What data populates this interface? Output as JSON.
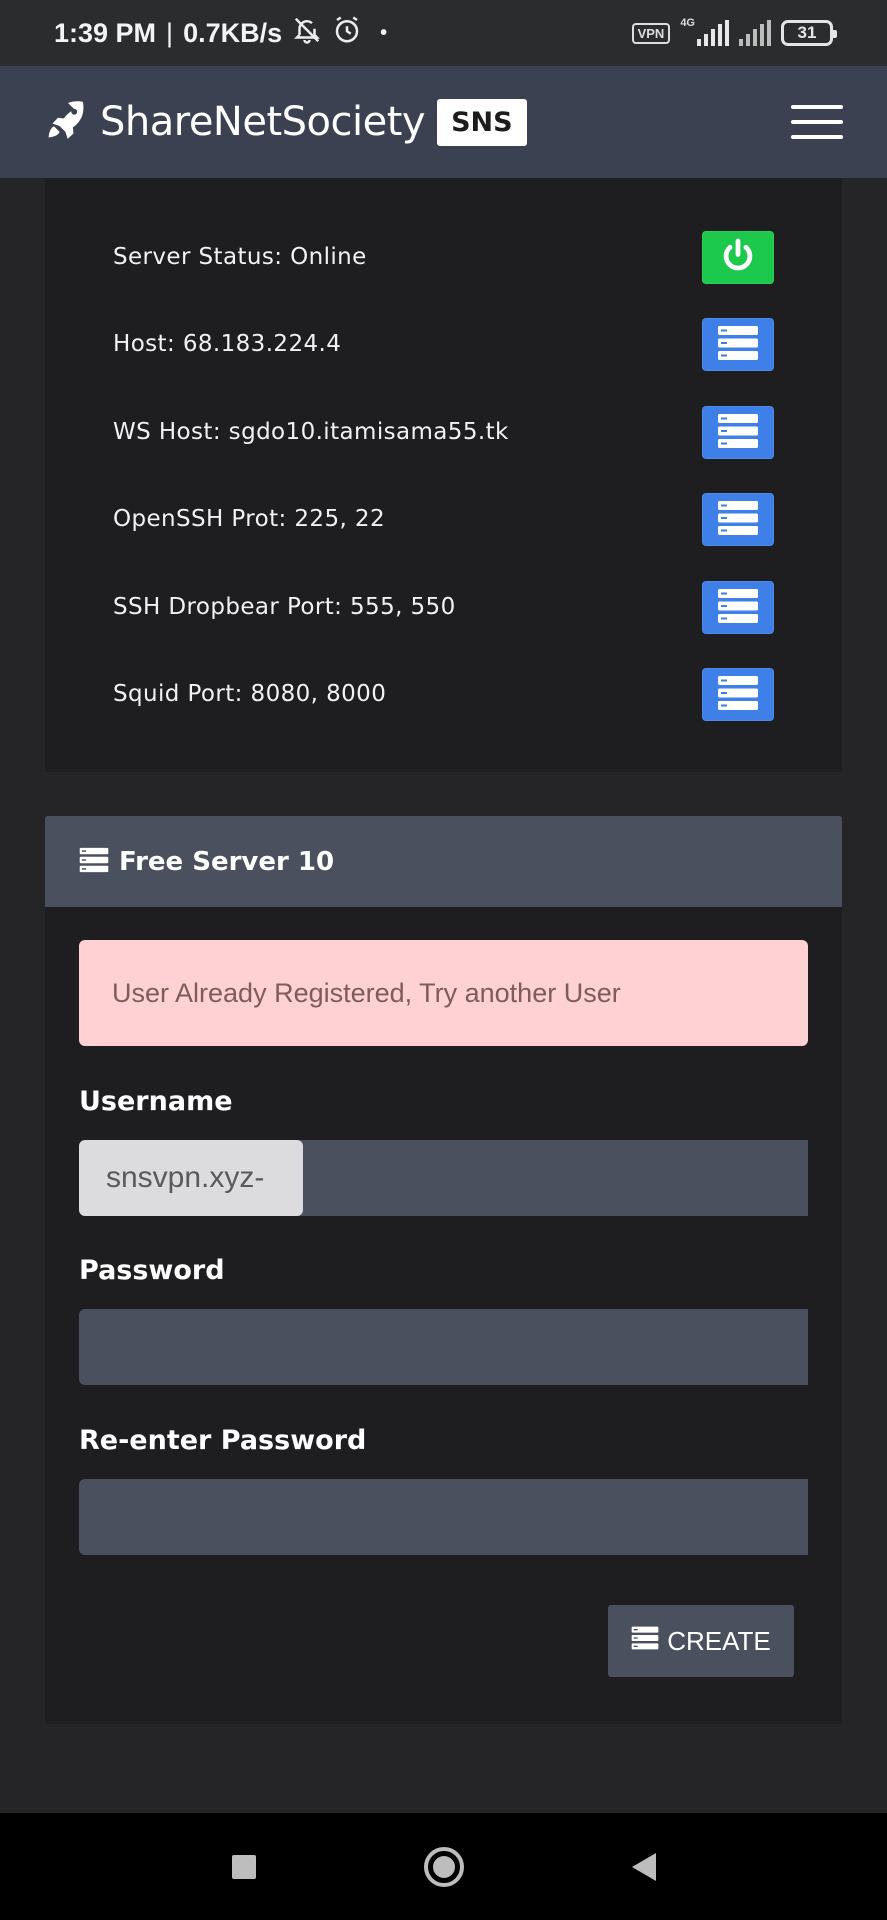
{
  "status_bar": {
    "time": "1:39 PM",
    "separator": "|",
    "speed": "0.7KB/s",
    "dot": "•",
    "vpn": "VPN",
    "network": "4G",
    "battery": "31",
    "icons": [
      "bell-off-icon",
      "alarm-icon",
      "signal-icon",
      "battery-icon"
    ]
  },
  "header": {
    "brand_name": "ShareNetSociety",
    "brand_badge": "SNS",
    "logo_icon": "rocket-icon",
    "menu_icon": "hamburger-icon"
  },
  "server_info": {
    "rows": [
      {
        "label": "Server Status: Online",
        "icon": "power-icon",
        "color": "#1dc94c"
      },
      {
        "label": "Host: 68.183.224.4",
        "icon": "server-icon",
        "color": "#3f7fe8"
      },
      {
        "label": "WS Host: sgdo10.itamisama55.tk",
        "icon": "server-icon",
        "color": "#3f7fe8"
      },
      {
        "label": "OpenSSH Prot: 225, 22",
        "icon": "server-icon",
        "color": "#3f7fe8"
      },
      {
        "label": "SSH Dropbear Port: 555, 550",
        "icon": "server-icon",
        "color": "#3f7fe8"
      },
      {
        "label": "Squid Port: 8080, 8000",
        "icon": "server-icon",
        "color": "#3f7fe8"
      }
    ]
  },
  "form": {
    "title": "Free Server 10",
    "alert": "User Already Registered, Try another User",
    "username_label": "Username",
    "username_prefix": "snsvpn.xyz-",
    "username_value": "",
    "password_label": "Password",
    "password_value": "",
    "reenter_label": "Re-enter Password",
    "reenter_value": "",
    "create_label": "CREATE"
  },
  "colors": {
    "background": "#252527",
    "card": "#1e1e20",
    "header": "#3b4150",
    "input": "#4a505e",
    "alert_bg": "#ffd1d3",
    "alert_text": "#7d5c5e"
  }
}
